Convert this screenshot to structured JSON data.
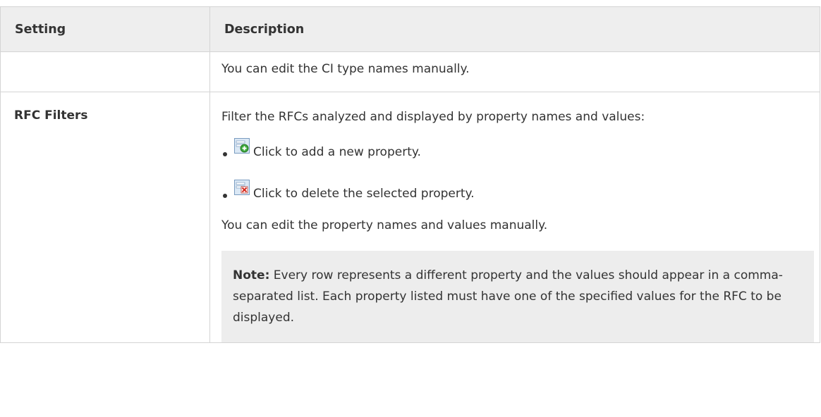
{
  "table": {
    "headers": {
      "setting": "Setting",
      "description": "Description"
    },
    "rows": [
      {
        "setting": "",
        "description": "You can edit the CI type names manually."
      },
      {
        "setting": "RFC Filters",
        "intro": "Filter the RFCs analyzed and displayed by property names and values:",
        "bullets": [
          {
            "icon": "add-property-icon",
            "text": "Click to add a new property."
          },
          {
            "icon": "delete-property-icon",
            "text": "Click to delete the selected property."
          }
        ],
        "outro": "You can edit the property names and values manually.",
        "note": {
          "label": "Note:",
          "text": " Every row represents a different property and the values should appear in a comma-separated list. Each property listed must have one of the specified values for the RFC to be displayed."
        }
      }
    ]
  },
  "colors": {
    "header_bg": "#eeeeee",
    "border": "#d4d4d4",
    "note_bg": "#ededed",
    "text": "#333333"
  }
}
